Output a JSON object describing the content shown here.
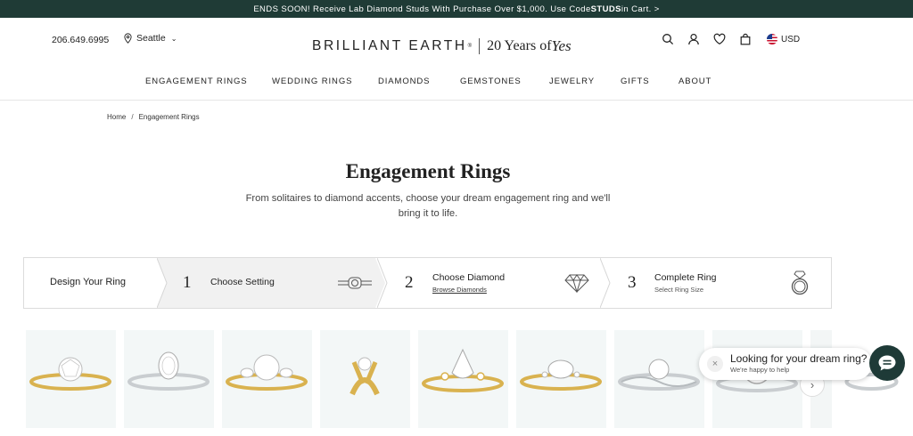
{
  "promo": {
    "text_before": "ENDS SOON! Receive Lab Diamond Studs With Purchase Over $1,000. Use Code ",
    "code": "STUDS",
    "text_after": " in Cart. >"
  },
  "header": {
    "phone": "206.649.6995",
    "location": "Seattle",
    "brand": "BRILLIANT EARTH",
    "brand_mark": "®",
    "tagline_years": "20 Years of ",
    "tagline_yes": "Yes",
    "currency": "USD"
  },
  "nav": [
    "ENGAGEMENT RINGS",
    "WEDDING RINGS",
    "DIAMONDS",
    "GEMSTONES",
    "JEWELRY",
    "GIFTS",
    "ABOUT"
  ],
  "breadcrumb": {
    "home": "Home",
    "separator": "/",
    "current": "Engagement Rings"
  },
  "page": {
    "title": "Engagement Rings",
    "subtitle": "From solitaires to diamond accents, choose your dream engagement ring and we'll bring it to life."
  },
  "steps": {
    "label": "Design Your Ring",
    "items": [
      {
        "number": "1",
        "title": "Choose Setting",
        "subtitle": ""
      },
      {
        "number": "2",
        "title": "Choose Diamond",
        "subtitle": "Browse Diamonds"
      },
      {
        "number": "3",
        "title": "Complete Ring",
        "subtitle": "Select Ring Size"
      }
    ]
  },
  "products": [
    {
      "metal": "gold",
      "style": "solitaire"
    },
    {
      "metal": "platinum",
      "style": "oval-pave"
    },
    {
      "metal": "gold",
      "style": "three-stone"
    },
    {
      "metal": "gold",
      "style": "prong-closeup"
    },
    {
      "metal": "gold",
      "style": "pear-vintage"
    },
    {
      "metal": "gold",
      "style": "oval-accent"
    },
    {
      "metal": "platinum",
      "style": "twist"
    },
    {
      "metal": "platinum",
      "style": "halo"
    },
    {
      "metal": "platinum",
      "style": "partial"
    }
  ],
  "chat": {
    "title": "Looking for your dream ring?",
    "subtitle": "We're happy to help",
    "close": "×"
  },
  "colors": {
    "promo_bg": "#1f3b36",
    "chat_button": "#1e3a37",
    "card_bg": "#f3f7f7",
    "gold": "#d9b24f",
    "platinum": "#c9cdd0"
  },
  "icons": [
    "location-pin-icon",
    "search-icon",
    "user-icon",
    "heart-icon",
    "bag-icon",
    "us-flag-icon",
    "ring-setting-icon",
    "diamond-icon",
    "ring-icon",
    "chat-icon",
    "close-icon",
    "chevron-right-icon"
  ]
}
